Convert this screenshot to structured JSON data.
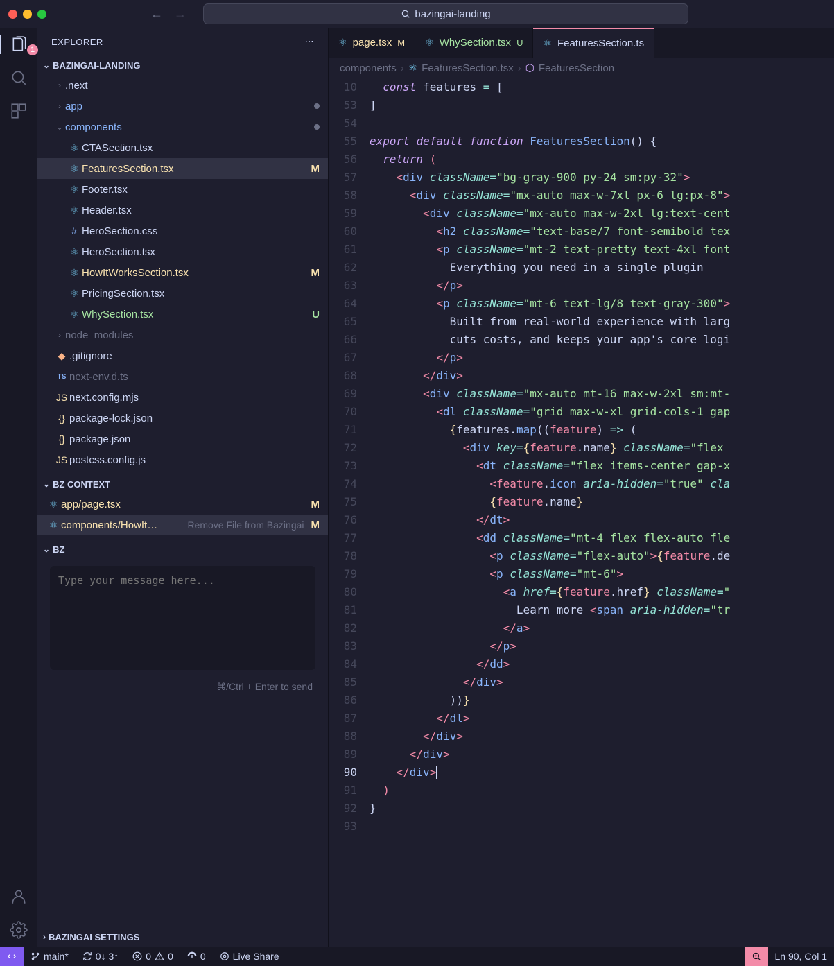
{
  "titlebar": {
    "search_text": "bazingai-landing"
  },
  "activity": {
    "badge": "1"
  },
  "sidebar": {
    "title": "EXPLORER",
    "project": "BAZINGAI-LANDING",
    "tree": [
      {
        "kind": "folder",
        "label": ".next",
        "depth": 1,
        "expanded": false
      },
      {
        "kind": "folder",
        "label": "app",
        "depth": 1,
        "expanded": false,
        "dot": true,
        "color": "blue"
      },
      {
        "kind": "folder",
        "label": "components",
        "depth": 1,
        "expanded": true,
        "dot": true,
        "color": "blue"
      },
      {
        "kind": "file",
        "label": "CTASection.tsx",
        "depth": 2,
        "icon": "react"
      },
      {
        "kind": "file",
        "label": "FeaturesSection.tsx",
        "depth": 2,
        "icon": "react",
        "status": "M",
        "selected": true,
        "color": "mod"
      },
      {
        "kind": "file",
        "label": "Footer.tsx",
        "depth": 2,
        "icon": "react"
      },
      {
        "kind": "file",
        "label": "Header.tsx",
        "depth": 2,
        "icon": "react"
      },
      {
        "kind": "file",
        "label": "HeroSection.css",
        "depth": 2,
        "icon": "css"
      },
      {
        "kind": "file",
        "label": "HeroSection.tsx",
        "depth": 2,
        "icon": "react"
      },
      {
        "kind": "file",
        "label": "HowItWorksSection.tsx",
        "depth": 2,
        "icon": "react",
        "status": "M",
        "color": "mod"
      },
      {
        "kind": "file",
        "label": "PricingSection.tsx",
        "depth": 2,
        "icon": "react"
      },
      {
        "kind": "file",
        "label": "WhySection.tsx",
        "depth": 2,
        "icon": "react",
        "status": "U",
        "color": "unt"
      },
      {
        "kind": "folder",
        "label": "node_modules",
        "depth": 1,
        "expanded": false,
        "color": "dim"
      },
      {
        "kind": "file",
        "label": ".gitignore",
        "depth": 1,
        "icon": "git"
      },
      {
        "kind": "file",
        "label": "next-env.d.ts",
        "depth": 1,
        "icon": "ts",
        "color": "dim"
      },
      {
        "kind": "file",
        "label": "next.config.mjs",
        "depth": 1,
        "icon": "js"
      },
      {
        "kind": "file",
        "label": "package-lock.json",
        "depth": 1,
        "icon": "json"
      },
      {
        "kind": "file",
        "label": "package.json",
        "depth": 1,
        "icon": "json"
      },
      {
        "kind": "file",
        "label": "postcss.config.js",
        "depth": 1,
        "icon": "js"
      }
    ],
    "bz_context": {
      "title": "BZ CONTEXT",
      "items": [
        {
          "label": "app/page.tsx",
          "status": "M",
          "color": "mod"
        },
        {
          "label": "components/HowIt…",
          "status": "M",
          "color": "mod",
          "action": "Remove File from Bazingai"
        }
      ]
    },
    "bz": {
      "title": "BZ",
      "placeholder": "Type your message here...",
      "hint": "⌘/Ctrl + Enter to send"
    },
    "settings": "BAZINGAI SETTINGS"
  },
  "tabs": [
    {
      "label": "page.tsx",
      "status": "M",
      "color": "mod"
    },
    {
      "label": "WhySection.tsx",
      "status": "U",
      "color": "unt"
    },
    {
      "label": "FeaturesSection.ts",
      "active": true
    }
  ],
  "breadcrumb": {
    "parts": [
      "components",
      "FeaturesSection.tsx",
      "FeaturesSection"
    ]
  },
  "code": {
    "line_numbers": [
      "10",
      "53",
      "54",
      "55",
      "56",
      "57",
      "58",
      "59",
      "60",
      "61",
      "62",
      "63",
      "64",
      "65",
      "66",
      "67",
      "68",
      "69",
      "70",
      "71",
      "72",
      "73",
      "74",
      "75",
      "76",
      "77",
      "78",
      "79",
      "80",
      "81",
      "82",
      "83",
      "84",
      "85",
      "86",
      "87",
      "88",
      "89",
      "90",
      "91",
      "92",
      "93"
    ],
    "active_line": "90"
  },
  "statusbar": {
    "branch": "main*",
    "sync": "0↓ 3↑",
    "errors": "0",
    "warnings": "0",
    "ports": "0",
    "live": "Live Share",
    "position": "Ln 90, Col 1"
  }
}
